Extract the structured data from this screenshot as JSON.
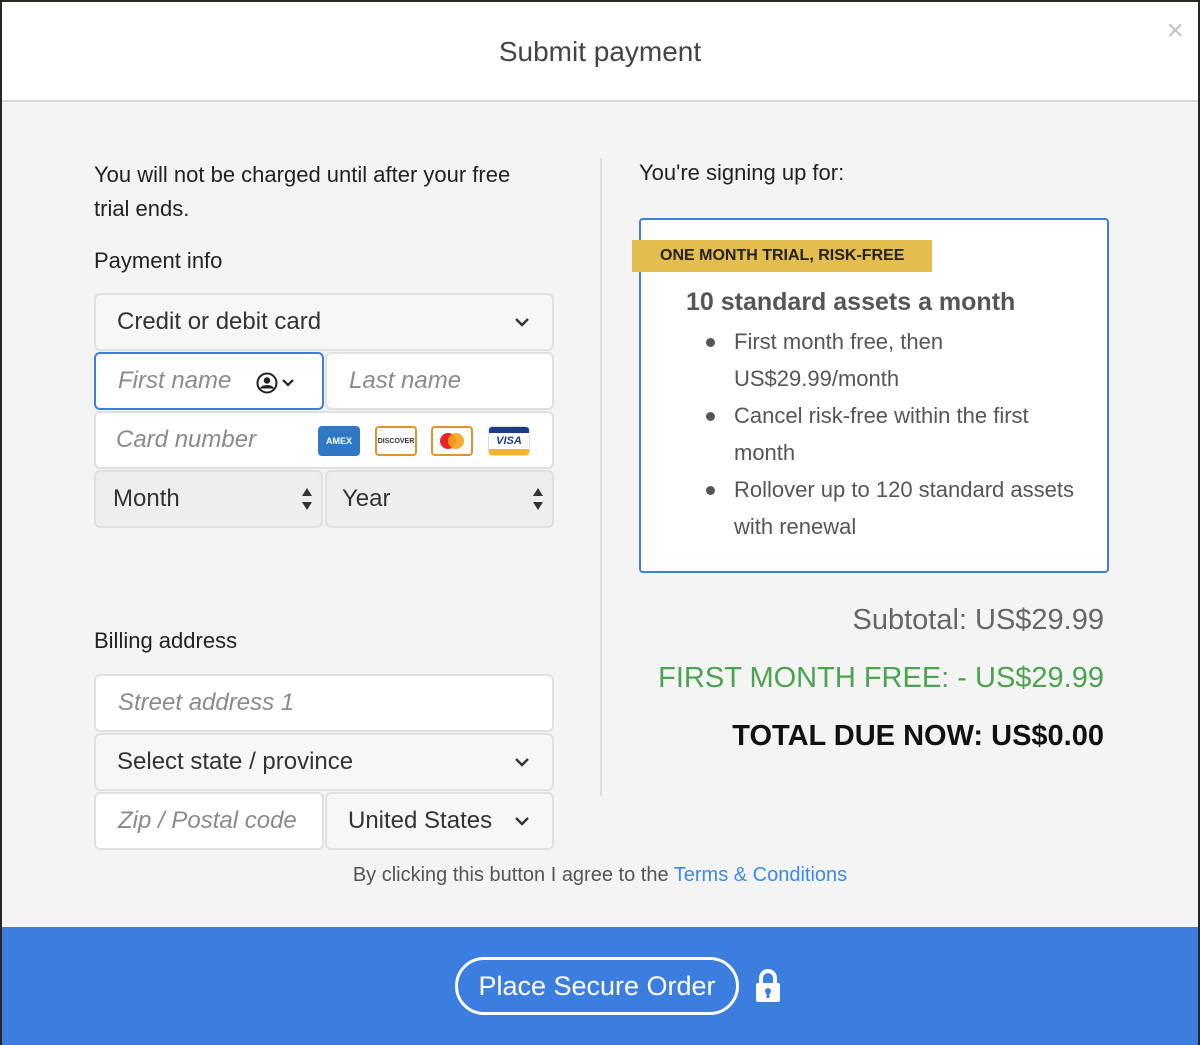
{
  "dialog": {
    "title": "Submit payment",
    "close_label": "×"
  },
  "left": {
    "notice": "You will not be charged until after your free trial ends.",
    "payment_label": "Payment info",
    "payment_method": "Credit or debit card",
    "first_name_placeholder": "First name",
    "last_name_placeholder": "Last name",
    "card_number_placeholder": "Card number",
    "card_logos": {
      "amex": "AMEX",
      "discover": "DISCOVER",
      "visa": "VISA"
    },
    "month_value": "Month",
    "year_value": "Year",
    "billing_label": "Billing address",
    "street_placeholder": "Street address 1",
    "state_value": "Select state / province",
    "zip_placeholder": "Zip / Postal code",
    "country_value": "United States"
  },
  "right": {
    "heading": "You're signing up for:",
    "ribbon": "ONE MONTH TRIAL, RISK-FREE",
    "plan_title": "10 standard assets a month",
    "bullets": [
      "First month free, then US$29.99/month",
      "Cancel risk-free within the first month",
      "Rollover up to 120 standard assets with renewal"
    ],
    "subtotal": "Subtotal: US$29.99",
    "discount": "FIRST MONTH FREE: - US$29.99",
    "total": "TOTAL DUE NOW: US$0.00"
  },
  "footer": {
    "terms_text": "By clicking this button I agree to the",
    "terms_link": "Terms & Conditions",
    "order_button": "Place Secure Order"
  },
  "colors": {
    "accent": "#3c7ee0",
    "discount_green": "#4aa34e",
    "ribbon_gold": "#e3bd4e"
  }
}
